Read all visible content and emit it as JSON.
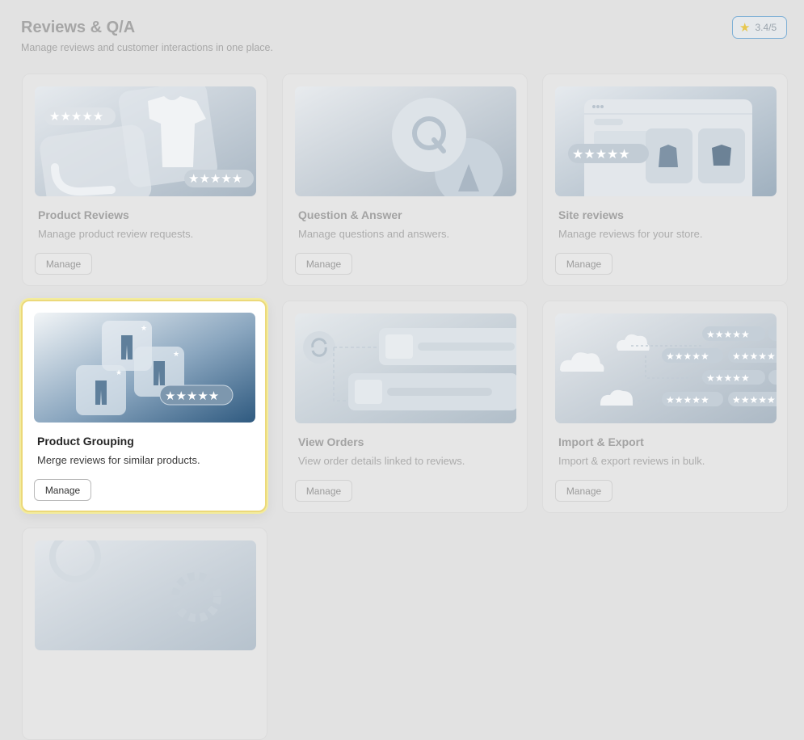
{
  "header": {
    "title": "Reviews & Q/A",
    "subtitle": "Manage reviews and customer interactions in one place."
  },
  "rating": {
    "value": "3.4/5",
    "icon": "star-icon",
    "color": "#e7c74f"
  },
  "colors": {
    "accent_border": "#ecd97a",
    "badge_border": "#7fb0d6"
  },
  "cards": [
    {
      "title": "Product Reviews",
      "description": "Manage product review requests.",
      "button": "Manage",
      "state": "disabled"
    },
    {
      "title": "Question & Answer",
      "description": "Manage questions and answers.",
      "button": "Manage",
      "state": "disabled"
    },
    {
      "title": "Site reviews",
      "description": "Manage reviews for your store.",
      "button": "Manage",
      "state": "disabled"
    },
    {
      "title": "Product Grouping",
      "description": "Merge reviews for similar products.",
      "button": "Manage",
      "state": "active"
    },
    {
      "title": "View Orders",
      "description": "View order details linked to reviews.",
      "button": "Manage",
      "state": "disabled"
    },
    {
      "title": "Import & Export",
      "description": "Import & export reviews in bulk.",
      "button": "Manage",
      "state": "disabled"
    },
    {
      "title": "",
      "description": "",
      "button": "",
      "state": "disabled"
    }
  ]
}
